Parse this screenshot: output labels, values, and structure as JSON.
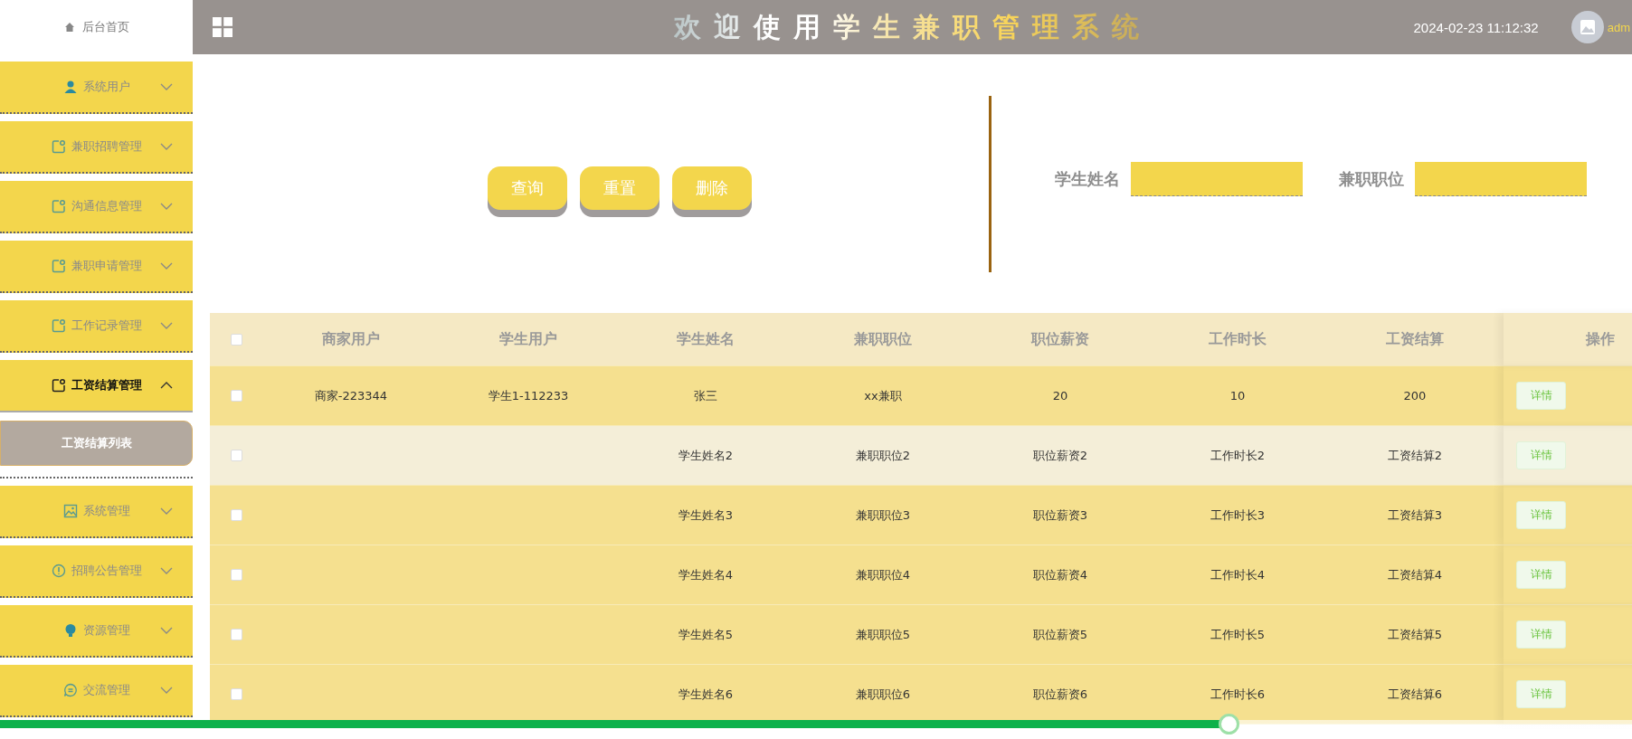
{
  "sidebar": {
    "home": "后台首页",
    "items": [
      {
        "label": "系统用户",
        "expanded": false
      },
      {
        "label": "兼职招聘管理",
        "expanded": false
      },
      {
        "label": "沟通信息管理",
        "expanded": false
      },
      {
        "label": "兼职申请管理",
        "expanded": false
      },
      {
        "label": "工作记录管理",
        "expanded": false
      },
      {
        "label": "工资结算管理",
        "expanded": true,
        "children": [
          {
            "label": "工资结算列表",
            "selected": true
          }
        ]
      },
      {
        "label": "系统管理",
        "expanded": false
      },
      {
        "label": "招聘公告管理",
        "expanded": false
      },
      {
        "label": "资源管理",
        "expanded": false
      },
      {
        "label": "交流管理",
        "expanded": false
      }
    ]
  },
  "header": {
    "title": "欢迎使用学生兼职管理系统",
    "datetime": "2024-02-23 11:12:32",
    "user": "adm"
  },
  "actions": [
    "查询",
    "重置",
    "删除"
  ],
  "search": [
    {
      "label": "学生姓名"
    },
    {
      "label": "兼职职位"
    }
  ],
  "table": {
    "all_checked": false,
    "columns": [
      "商家用户",
      "学生用户",
      "学生姓名",
      "兼职职位",
      "职位薪资",
      "工作时长",
      "工资结算",
      "操作"
    ],
    "rows": [
      {
        "checked": false,
        "hovered": false,
        "cells": [
          "商家-223344",
          "学生1-112233",
          "张三",
          "xx兼职",
          "20",
          "10",
          "200"
        ],
        "action": "详情"
      },
      {
        "checked": false,
        "hovered": true,
        "cells": [
          "",
          "",
          "学生姓名2",
          "兼职职位2",
          "职位薪资2",
          "工作时长2",
          "工资结算2"
        ],
        "action": "详情"
      },
      {
        "checked": false,
        "hovered": false,
        "cells": [
          "",
          "",
          "学生姓名3",
          "兼职职位3",
          "职位薪资3",
          "工作时长3",
          "工资结算3"
        ],
        "action": "详情"
      },
      {
        "checked": false,
        "hovered": false,
        "cells": [
          "",
          "",
          "学生姓名4",
          "兼职职位4",
          "职位薪资4",
          "工作时长4",
          "工资结算4"
        ],
        "action": "详情"
      },
      {
        "checked": false,
        "hovered": false,
        "cells": [
          "",
          "",
          "学生姓名5",
          "兼职职位5",
          "职位薪资5",
          "工作时长5",
          "工资结算5"
        ],
        "action": "详情"
      },
      {
        "checked": false,
        "hovered": false,
        "cells": [
          "",
          "",
          "学生姓名6",
          "兼职职位6",
          "职位薪资6",
          "工作时长6",
          "工资结算6"
        ],
        "action": "详情"
      }
    ]
  },
  "playback": {
    "level": 0.753
  }
}
